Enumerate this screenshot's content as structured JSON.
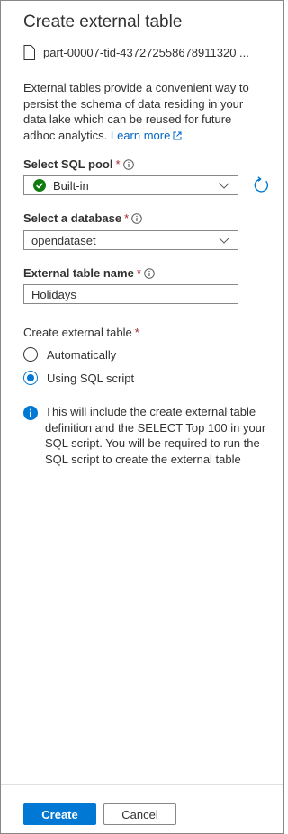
{
  "panel": {
    "title": "Create external table",
    "file_name": "part-00007-tid-437272558678911320 ...",
    "description_text": "External tables provide a convenient way to persist the schema of data residing in your data lake which can be reused for future adhoc analytics.",
    "learn_more_label": "Learn more"
  },
  "sql_pool": {
    "label": "Select SQL pool",
    "required": "*",
    "value": "Built-in"
  },
  "database": {
    "label": "Select a database",
    "required": "*",
    "value": "opendataset"
  },
  "table_name": {
    "label": "External table name",
    "required": "*",
    "value": "Holidays"
  },
  "create_mode": {
    "label": "Create external table",
    "required": "*",
    "options": [
      "Automatically",
      "Using SQL script"
    ],
    "selected": "Using SQL script"
  },
  "note": {
    "text": "This will include the create external table definition and the SELECT Top 100 in your SQL script. You will be required to run the SQL script to create the external table"
  },
  "footer": {
    "create_label": "Create",
    "cancel_label": "Cancel"
  },
  "colors": {
    "accent": "#0078d4",
    "success": "#107c10",
    "required": "#a4262c",
    "link": "#0066c4"
  },
  "icons": [
    "file-icon",
    "external-link-icon",
    "info-icon",
    "check-circle-icon",
    "chevron-down-icon",
    "refresh-icon"
  ]
}
